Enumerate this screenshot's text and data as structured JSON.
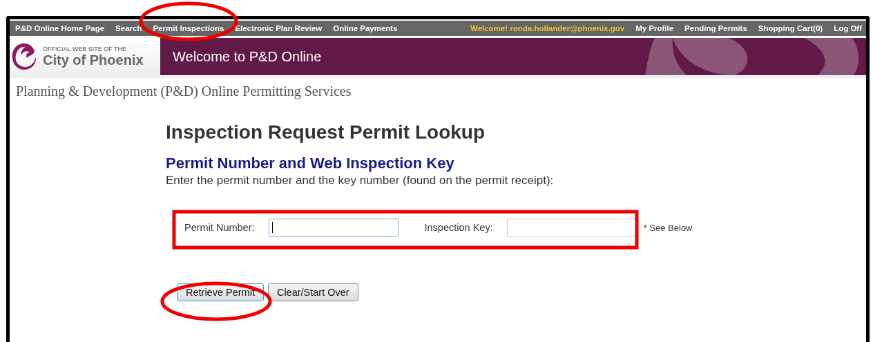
{
  "nav": {
    "left": [
      {
        "label": "P&D Online Home Page"
      },
      {
        "label": "Search"
      },
      {
        "label": "Permit Inspections"
      },
      {
        "label": "Electronic Plan Review"
      },
      {
        "label": "Online Payments"
      }
    ],
    "welcome": "Welcome! ronda.hollander@phoenix.gov",
    "right": [
      {
        "label": "My Profile"
      },
      {
        "label": "Pending Permits"
      },
      {
        "label": "Shopping Cart(0)"
      },
      {
        "label": "Log Off"
      }
    ]
  },
  "logo": {
    "small": "OFFICIAL WEB SITE OF THE",
    "big": "City of Phoenix"
  },
  "banner": "Welcome to P&D Online",
  "site_title": "Planning & Development (P&D) Online Permitting Services",
  "heading": "Inspection Request Permit Lookup",
  "subheading": "Permit Number and Web Inspection Key",
  "instruction": "Enter the permit number and the key number (found on the permit receipt):",
  "fields": [
    {
      "label": "Permit Number:",
      "focused": true
    },
    {
      "label": "Inspection Key:",
      "focused": false
    }
  ],
  "note": "* See Below",
  "buttons": [
    {
      "label": "Retrieve Permit",
      "focused": true
    },
    {
      "label": "Clear/Start Over",
      "focused": false
    }
  ],
  "annotations": [
    {
      "kind": "ellipse"
    },
    {
      "kind": "box"
    },
    {
      "kind": "ellipse"
    }
  ]
}
